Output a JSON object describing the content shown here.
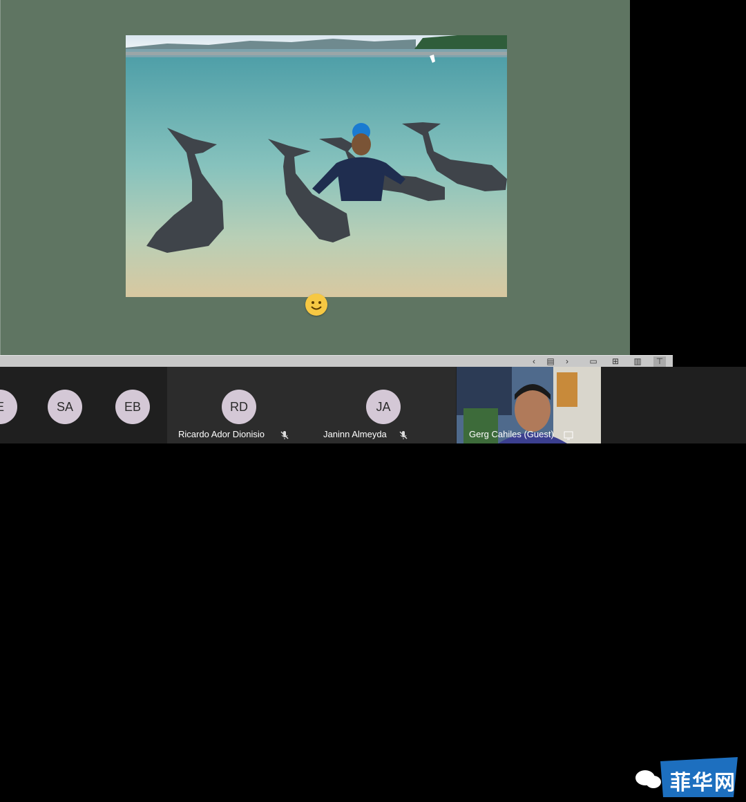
{
  "slide": {
    "photo_alt": "Man in wetsuit posing in shallow water with dolphins",
    "reaction": "smiley-emoji"
  },
  "toolbar": {
    "items": [
      "prev-slide-icon",
      "slide-list-icon",
      "next-slide-icon",
      "normal-view-icon",
      "grid-view-icon",
      "reading-view-icon",
      "presenter-view-icon"
    ]
  },
  "participants": [
    {
      "initials": "E"
    },
    {
      "initials": "SA"
    },
    {
      "initials": "EB"
    },
    {
      "initials": "RD",
      "name": "Ricardo Ador Dionisio",
      "muted": true
    },
    {
      "initials": "JA",
      "name": "Janinn Almeyda",
      "muted": true
    },
    {
      "name": "Gerg Cahiles (Guest)",
      "has_video": true
    }
  ],
  "watermark": {
    "text": "菲华网"
  }
}
